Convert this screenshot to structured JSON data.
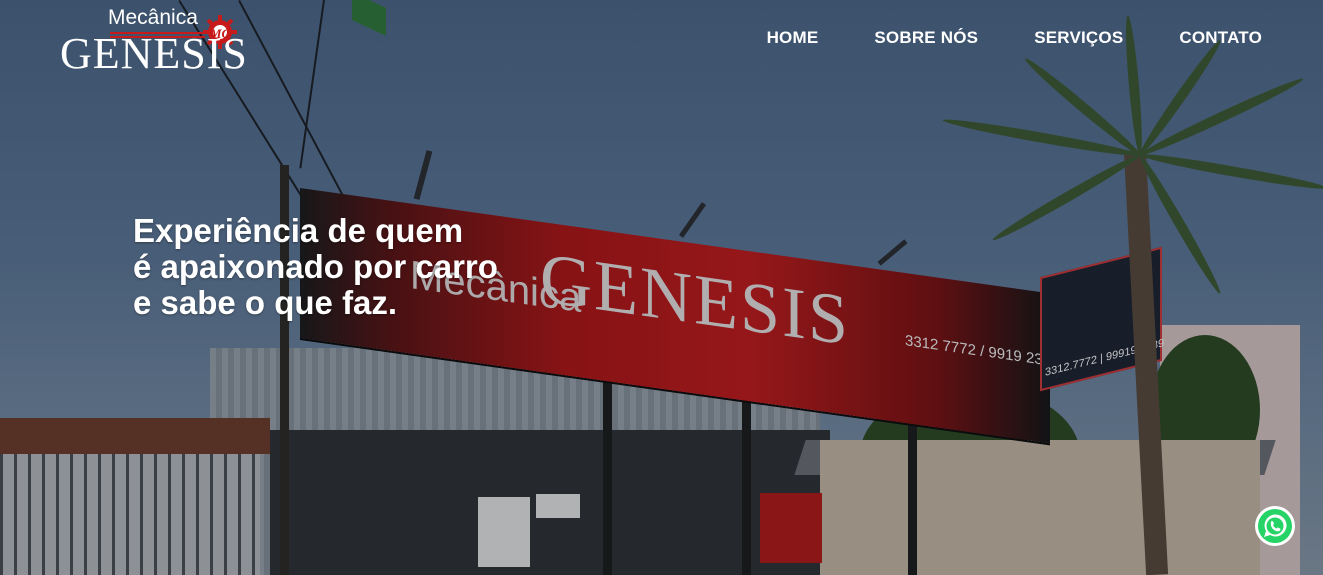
{
  "brand": {
    "small_text": "Mecânica",
    "main_text": "GENESIS",
    "badge": "MG",
    "accent_color": "#c71a1a"
  },
  "nav": {
    "items": [
      {
        "label": "HOME"
      },
      {
        "label": "SOBRE NÓS"
      },
      {
        "label": "SERVIÇOS"
      },
      {
        "label": "CONTATO"
      }
    ]
  },
  "hero": {
    "headline_lines": [
      "Experiência de quem",
      "é apaixonado por carro",
      "e sabe o que faz."
    ]
  },
  "scene": {
    "billboard_small": "Mecânica",
    "billboard_main": "GENESIS",
    "billboard_phone": "3312 7772 / 9919 2389",
    "side_sign_phone": "3312.7772 | 99919.2389"
  },
  "whatsapp": {
    "icon": "whatsapp-icon",
    "color": "#25d366"
  }
}
